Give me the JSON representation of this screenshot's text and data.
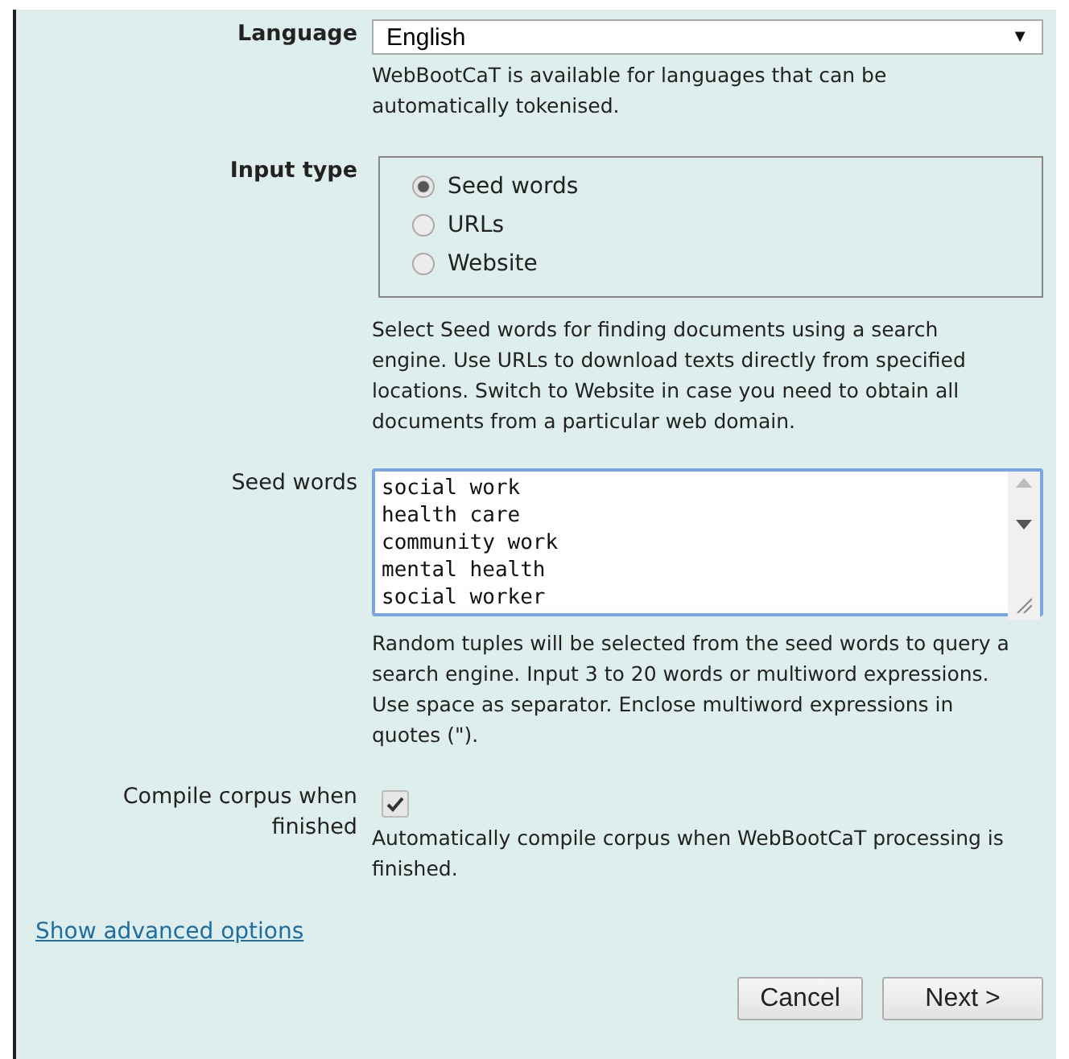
{
  "language": {
    "label": "Language",
    "value": "English",
    "arrow": "▼",
    "help": "WebBootCaT is available for languages that can be automatically tokenised."
  },
  "input_type": {
    "label": "Input type",
    "options": [
      {
        "label": "Seed words",
        "selected": true
      },
      {
        "label": "URLs",
        "selected": false
      },
      {
        "label": "Website",
        "selected": false
      }
    ],
    "help": "Select Seed words for finding documents using a search engine. Use URLs to download texts directly from specified locations. Switch to Website in case you need to obtain all documents from a particular web domain."
  },
  "seed_words": {
    "label": "Seed words",
    "lines": [
      "social work",
      "health care",
      "community work",
      "mental health",
      "social worker"
    ],
    "help": "Random tuples will be selected from the seed words to query a search engine. Input 3 to 20 words or multiword expressions. Use space as separator. Enclose multiword expressions in quotes (\")."
  },
  "compile": {
    "label": "Compile corpus when finished",
    "checked": true,
    "help": "Automatically compile corpus when WebBootCaT processing is finished."
  },
  "advanced_link": "Show advanced options",
  "buttons": [
    "Cancel",
    "Next >"
  ]
}
